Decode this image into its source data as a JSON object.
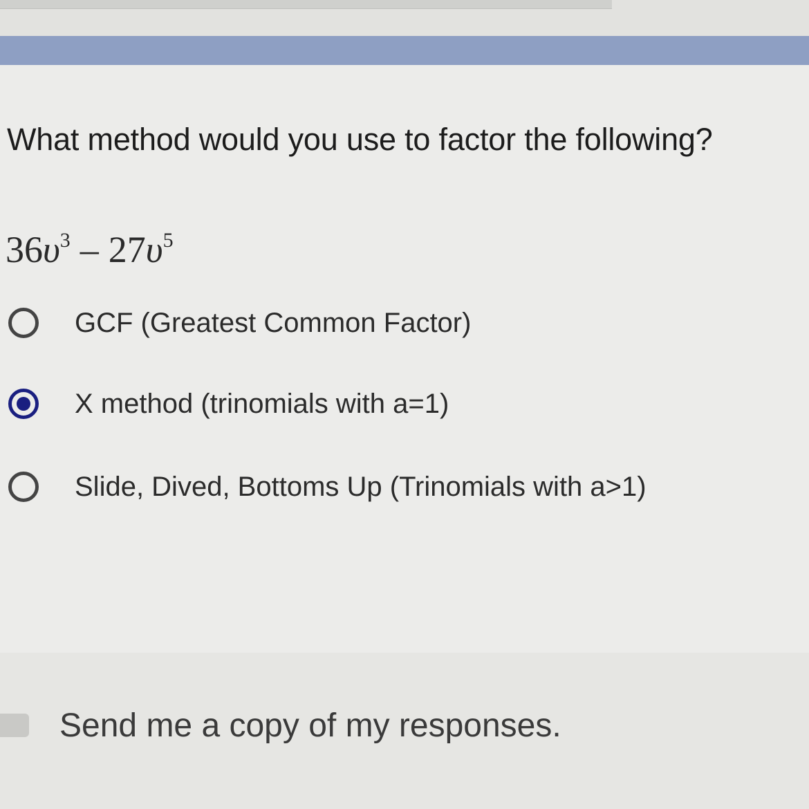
{
  "question": {
    "title": "What method would you use to factor the following?",
    "expression": {
      "term1_coef": "36",
      "term1_var": "υ",
      "term1_exp": "3",
      "operator": "–",
      "term2_coef": "27",
      "term2_var": "υ",
      "term2_exp": "5"
    }
  },
  "options": [
    {
      "label": "GCF (Greatest Common Factor)",
      "selected": false
    },
    {
      "label": "X method (trinomials with a=1)",
      "selected": true
    },
    {
      "label": "Slide, Dived, Bottoms Up (Trinomials with a>1)",
      "selected": false
    }
  ],
  "footer": {
    "copy_label": "Send me a copy of my responses."
  },
  "colors": {
    "accent": "#8e9fc3",
    "radio_selected": "#1a1f80"
  }
}
